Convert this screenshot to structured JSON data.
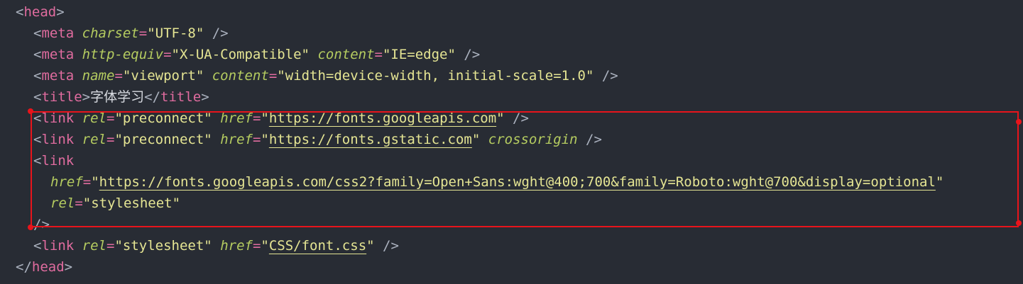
{
  "editor": {
    "language": "html",
    "lines": [
      {
        "tag_open": "<",
        "tag": "head",
        "tag_close": ">"
      },
      {
        "tag_open": "<",
        "tag": "meta",
        "a1": "charset",
        "v1": "\"UTF-8\"",
        "end": " />"
      },
      {
        "tag_open": "<",
        "tag": "meta",
        "a1": "http-equiv",
        "v1": "\"X-UA-Compatible\"",
        "a2": "content",
        "v2": "\"IE=edge\"",
        "end": " />"
      },
      {
        "tag_open": "<",
        "tag": "meta",
        "a1": "name",
        "v1": "\"viewport\"",
        "a2": "content",
        "v2": "\"width=device-width, initial-scale=1.0\"",
        "end": " />"
      },
      {
        "tag_open": "<",
        "tag": "title",
        "tag_close": ">",
        "text": "字体学习",
        "close_open": "</",
        "close_tag": "title",
        "close_end": ">"
      },
      {
        "tag_open": "<",
        "tag": "link",
        "a1": "rel",
        "v1": "\"preconnect\"",
        "a2": "href",
        "q_open": "\"",
        "url": "https://fonts.googleapis.com",
        "q_close": "\"",
        "end": " />"
      },
      {
        "tag_open": "<",
        "tag": "link",
        "a1": "rel",
        "v1": "\"preconnect\"",
        "a2": "href",
        "q_open": "\"",
        "url": "https://fonts.gstatic.com",
        "q_close": "\"",
        "a3": "crossorigin",
        "end": " />"
      },
      {
        "tag_open": "<",
        "tag": "link"
      },
      {
        "a1": "href",
        "q_open": "\"",
        "url": "https://fonts.googleapis.com/css2?family=Open+Sans:wght@400;700&family=Roboto:wght@700&display=optional",
        "q_close": "\""
      },
      {
        "a1": "rel",
        "v1": "\"stylesheet\""
      },
      {
        "end": "/>"
      },
      {
        "tag_open": "<",
        "tag": "link",
        "a1": "rel",
        "v1": "\"stylesheet\"",
        "a2": "href",
        "q_open": "\"",
        "url": "CSS/font.css",
        "q_close": "\"",
        "end": " />"
      },
      {
        "tag_open": "</",
        "tag": "head",
        "tag_close": ">"
      }
    ]
  },
  "colors": {
    "background": "#282c34",
    "tag": "#e06c9f",
    "attribute": "#b5cc60",
    "string": "#e5e593",
    "highlight_box": "#e8141b"
  }
}
